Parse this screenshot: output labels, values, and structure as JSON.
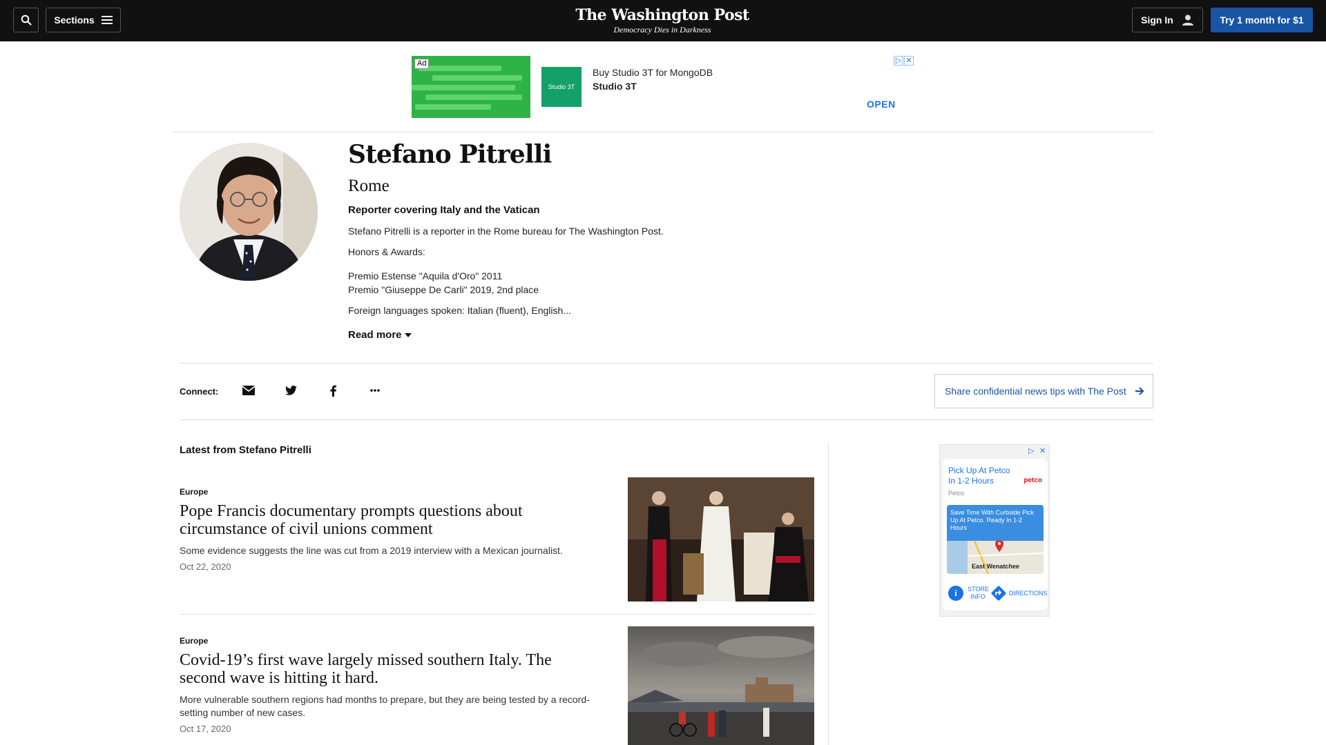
{
  "header": {
    "logo": "The Washington Post",
    "tagline": "Democracy Dies in Darkness",
    "sections_label": "Sections",
    "sign_in_label": "Sign In",
    "subscribe_label": "Try 1 month for $1",
    "accent_color": "#1955a5"
  },
  "top_ad": {
    "badge": "Ad",
    "logo_text": "Studio 3T",
    "line1": "Buy Studio 3T for MongoDB",
    "line2": "Studio 3T",
    "cta": "OPEN"
  },
  "author": {
    "name": "Stefano Pitrelli",
    "location": "Rome",
    "title": "Reporter covering Italy and the Vatican",
    "bio": "Stefano Pitrelli is a reporter in the Rome bureau for The Washington Post.",
    "honors_label": "Honors & Awards:",
    "honors": [
      "Premio Estense \"Aquila d'Oro\" 2011",
      "Premio \"Giuseppe De Carli\" 2019, 2nd place"
    ],
    "languages": "Foreign languages spoken: Italian (fluent), English...",
    "read_more": "Read more"
  },
  "connect": {
    "label": "Connect:",
    "icons": [
      "envelope-icon",
      "twitter-icon",
      "facebook-icon",
      "more-icon"
    ],
    "tips_label": "Share confidential news tips with The Post"
  },
  "latest": {
    "title": "Latest from Stefano Pitrelli",
    "stories": [
      {
        "kicker": "Europe",
        "headline": "Pope Francis documentary prompts questions about circumstance of civil unions comment",
        "blurb": "Some evidence suggests the line was cut from a 2019 interview with a Mexican journalist.",
        "date": "Oct 22, 2020"
      },
      {
        "kicker": "Europe",
        "headline": "Covid-19’s first wave largely missed southern Italy. The second wave is hitting it hard.",
        "blurb": "More vulnerable southern regions had months to prepare, but they are being tested by a record-setting number of new cases.",
        "date": "Oct 17, 2020"
      }
    ]
  },
  "side_ad": {
    "headline": "Pick Up At Petco In 1-2 Hours",
    "brand": "petco",
    "sub": "Petco",
    "promo": "Save Time With Curbside Pick Up At Petco. Ready In 1-2 Hours",
    "city": "East Wenatchee",
    "store_info": "STORE INFO",
    "directions": "DIRECTIONS"
  }
}
